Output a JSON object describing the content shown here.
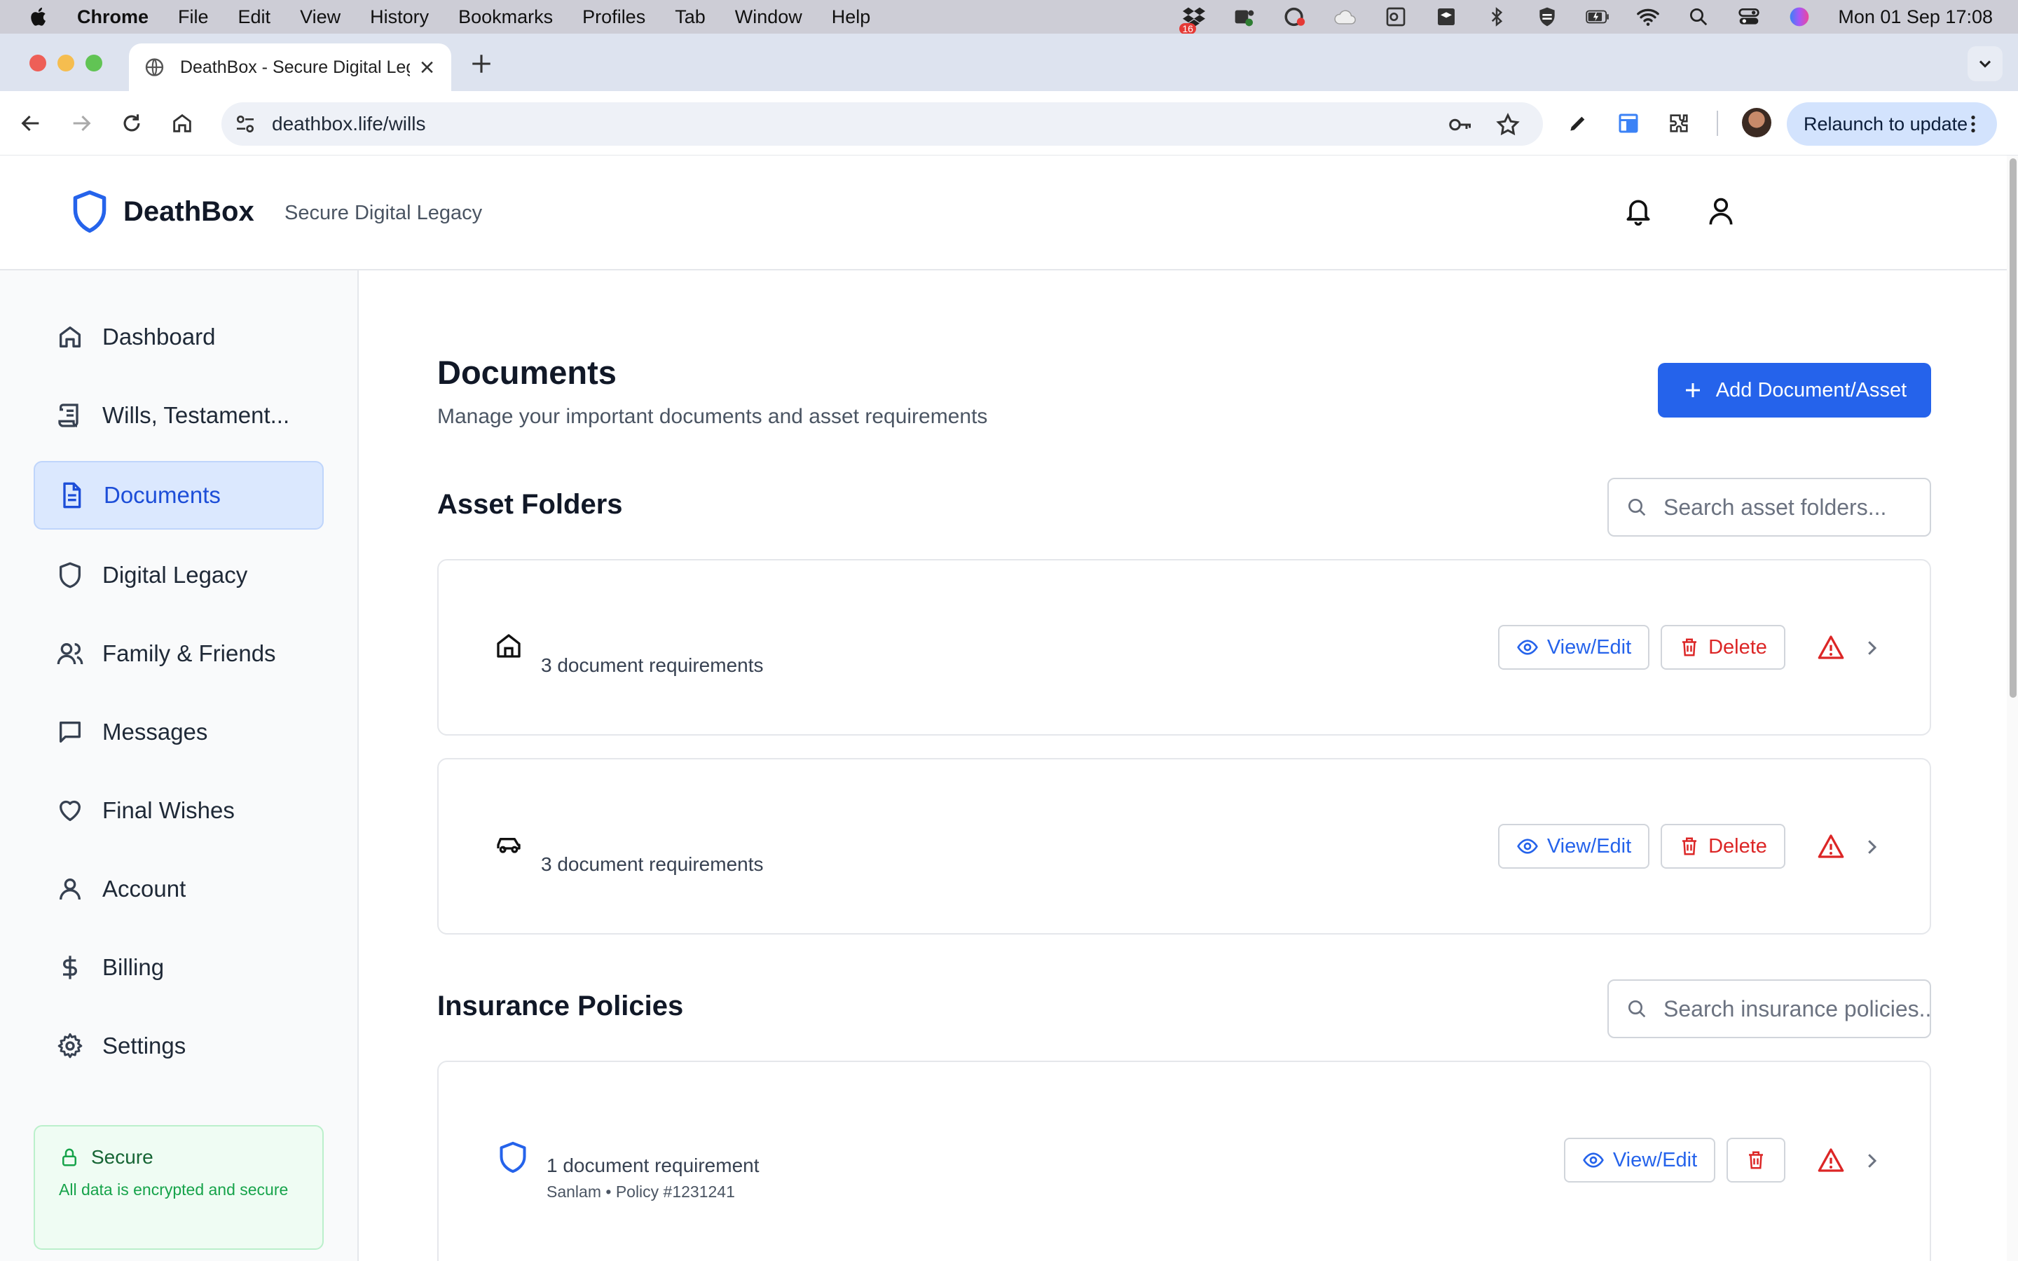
{
  "menubar": {
    "app": "Chrome",
    "items": [
      "File",
      "Edit",
      "View",
      "History",
      "Bookmarks",
      "Profiles",
      "Tab",
      "Window",
      "Help"
    ],
    "badge": "16",
    "clock": "Mon 01 Sep  17:08"
  },
  "browser": {
    "tab_title": "DeathBox - Secure Digital Legacy",
    "url": "deathbox.life/wills",
    "relaunch_label": "Relaunch to update"
  },
  "header": {
    "brand": "DeathBox",
    "tagline": "Secure Digital Legacy"
  },
  "sidebar": {
    "items": [
      {
        "label": "Dashboard",
        "icon": "home-icon"
      },
      {
        "label": "Wills, Testament...",
        "icon": "scroll-icon"
      },
      {
        "label": "Documents",
        "icon": "document-icon"
      },
      {
        "label": "Digital Legacy",
        "icon": "shield-icon"
      },
      {
        "label": "Family & Friends",
        "icon": "users-icon"
      },
      {
        "label": "Messages",
        "icon": "message-icon"
      },
      {
        "label": "Final Wishes",
        "icon": "heart-icon"
      },
      {
        "label": "Account",
        "icon": "user-icon"
      },
      {
        "label": "Billing",
        "icon": "dollar-icon"
      },
      {
        "label": "Settings",
        "icon": "gear-icon"
      }
    ],
    "active": "Documents",
    "secure_title": "Secure",
    "secure_text": "All data is encrypted and secure"
  },
  "main": {
    "title": "Documents",
    "subtitle": "Manage your important documents and asset requirements",
    "add_button": "Add Document/Asset",
    "asset_section": {
      "title": "Asset Folders",
      "search_placeholder": "Search asset folders...",
      "cards": [
        {
          "icon": "house-icon",
          "text": "3 document requirements"
        },
        {
          "icon": "car-icon",
          "text": "3 document requirements"
        }
      ]
    },
    "insurance_section": {
      "title": "Insurance Policies",
      "search_placeholder": "Search insurance policies...",
      "cards": [
        {
          "icon": "shield-icon",
          "text": "1 document requirement",
          "sub": "Sanlam • Policy #1231241"
        }
      ]
    },
    "view_label": "View/Edit",
    "delete_label": "Delete"
  },
  "colors": {
    "primary": "#2563eb",
    "danger": "#dc2626",
    "success": "#16a34a",
    "active_bg": "#dbe8fe"
  }
}
